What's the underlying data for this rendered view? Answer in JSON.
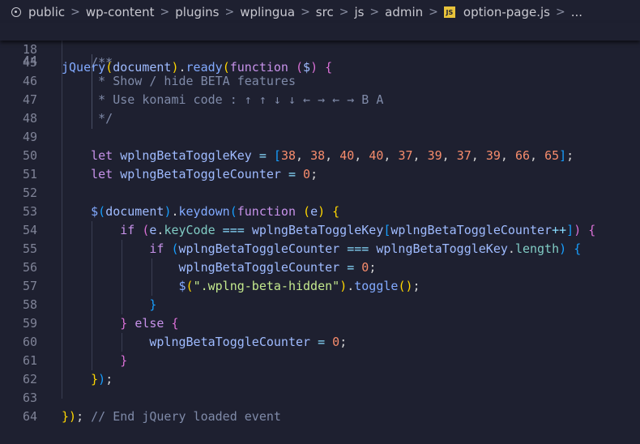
{
  "breadcrumb": {
    "items": [
      "public",
      "wp-content",
      "plugins",
      "wplingua",
      "src",
      "js",
      "admin",
      "option-page.js",
      "..."
    ],
    "separator": ">",
    "file_icon": "JS"
  },
  "sticky": {
    "line_number": "18",
    "tokens": [
      {
        "t": "jQuery",
        "c": "fn"
      },
      {
        "t": "(",
        "c": "yl"
      },
      {
        "t": "document",
        "c": "var"
      },
      {
        "t": ")",
        "c": "yl"
      },
      {
        "t": ".",
        "c": "pl"
      },
      {
        "t": "ready",
        "c": "fn"
      },
      {
        "t": "(",
        "c": "yl"
      },
      {
        "t": "function",
        "c": "kw"
      },
      {
        "t": " ",
        "c": "pl"
      },
      {
        "t": "(",
        "c": "pk"
      },
      {
        "t": "$",
        "c": "var"
      },
      {
        "t": ")",
        "c": "pk"
      },
      {
        "t": " ",
        "c": "pl"
      },
      {
        "t": "{",
        "c": "pk"
      }
    ]
  },
  "peek_line_number": "44",
  "lines": [
    {
      "n": "45",
      "indent": "    ",
      "tokens": [
        {
          "t": "/**",
          "c": "cm"
        }
      ]
    },
    {
      "n": "46",
      "indent": "     ",
      "tokens": [
        {
          "t": "* Show / hide BETA features",
          "c": "cm"
        }
      ]
    },
    {
      "n": "47",
      "indent": "     ",
      "tokens": [
        {
          "t": "* Use konami code : ↑ ↑ ↓ ↓ ← → ← → B A",
          "c": "cm"
        }
      ]
    },
    {
      "n": "48",
      "indent": "     ",
      "tokens": [
        {
          "t": "*/",
          "c": "cm"
        }
      ]
    },
    {
      "n": "49",
      "indent": "",
      "tokens": []
    },
    {
      "n": "50",
      "indent": "    ",
      "tokens": [
        {
          "t": "let",
          "c": "kw"
        },
        {
          "t": " ",
          "c": "pl"
        },
        {
          "t": "wplngBetaToggleKey",
          "c": "var"
        },
        {
          "t": " = ",
          "c": "op"
        },
        {
          "t": "[",
          "c": "bl"
        },
        {
          "t": "38",
          "c": "num"
        },
        {
          "t": ", ",
          "c": "pl"
        },
        {
          "t": "38",
          "c": "num"
        },
        {
          "t": ", ",
          "c": "pl"
        },
        {
          "t": "40",
          "c": "num"
        },
        {
          "t": ", ",
          "c": "pl"
        },
        {
          "t": "40",
          "c": "num"
        },
        {
          "t": ", ",
          "c": "pl"
        },
        {
          "t": "37",
          "c": "num"
        },
        {
          "t": ", ",
          "c": "pl"
        },
        {
          "t": "39",
          "c": "num"
        },
        {
          "t": ", ",
          "c": "pl"
        },
        {
          "t": "37",
          "c": "num"
        },
        {
          "t": ", ",
          "c": "pl"
        },
        {
          "t": "39",
          "c": "num"
        },
        {
          "t": ", ",
          "c": "pl"
        },
        {
          "t": "66",
          "c": "num"
        },
        {
          "t": ", ",
          "c": "pl"
        },
        {
          "t": "65",
          "c": "num"
        },
        {
          "t": "]",
          "c": "bl"
        },
        {
          "t": ";",
          "c": "pl"
        }
      ]
    },
    {
      "n": "51",
      "indent": "    ",
      "tokens": [
        {
          "t": "let",
          "c": "kw"
        },
        {
          "t": " ",
          "c": "pl"
        },
        {
          "t": "wplngBetaToggleCounter",
          "c": "var"
        },
        {
          "t": " = ",
          "c": "op"
        },
        {
          "t": "0",
          "c": "num"
        },
        {
          "t": ";",
          "c": "pl"
        }
      ]
    },
    {
      "n": "52",
      "indent": "",
      "tokens": []
    },
    {
      "n": "53",
      "indent": "    ",
      "tokens": [
        {
          "t": "$",
          "c": "fn"
        },
        {
          "t": "(",
          "c": "bl"
        },
        {
          "t": "document",
          "c": "var"
        },
        {
          "t": ")",
          "c": "bl"
        },
        {
          "t": ".",
          "c": "pl"
        },
        {
          "t": "keydown",
          "c": "fn"
        },
        {
          "t": "(",
          "c": "bl"
        },
        {
          "t": "function",
          "c": "kw"
        },
        {
          "t": " ",
          "c": "pl"
        },
        {
          "t": "(",
          "c": "yl"
        },
        {
          "t": "e",
          "c": "var"
        },
        {
          "t": ")",
          "c": "yl"
        },
        {
          "t": " ",
          "c": "pl"
        },
        {
          "t": "{",
          "c": "yl"
        }
      ]
    },
    {
      "n": "54",
      "indent": "        ",
      "tokens": [
        {
          "t": "if",
          "c": "kw"
        },
        {
          "t": " ",
          "c": "pl"
        },
        {
          "t": "(",
          "c": "pk"
        },
        {
          "t": "e",
          "c": "var"
        },
        {
          "t": ".",
          "c": "pl"
        },
        {
          "t": "keyCode",
          "c": "prp"
        },
        {
          "t": " === ",
          "c": "op"
        },
        {
          "t": "wplngBetaToggleKey",
          "c": "var"
        },
        {
          "t": "[",
          "c": "bl"
        },
        {
          "t": "wplngBetaToggleCounter",
          "c": "var"
        },
        {
          "t": "++",
          "c": "op"
        },
        {
          "t": "]",
          "c": "bl"
        },
        {
          "t": ")",
          "c": "pk"
        },
        {
          "t": " ",
          "c": "pl"
        },
        {
          "t": "{",
          "c": "pk"
        }
      ]
    },
    {
      "n": "55",
      "indent": "            ",
      "tokens": [
        {
          "t": "if",
          "c": "kw"
        },
        {
          "t": " ",
          "c": "pl"
        },
        {
          "t": "(",
          "c": "bl"
        },
        {
          "t": "wplngBetaToggleCounter",
          "c": "var"
        },
        {
          "t": " === ",
          "c": "op"
        },
        {
          "t": "wplngBetaToggleKey",
          "c": "var"
        },
        {
          "t": ".",
          "c": "pl"
        },
        {
          "t": "length",
          "c": "prp"
        },
        {
          "t": ")",
          "c": "bl"
        },
        {
          "t": " ",
          "c": "pl"
        },
        {
          "t": "{",
          "c": "bl"
        }
      ]
    },
    {
      "n": "56",
      "indent": "                ",
      "tokens": [
        {
          "t": "wplngBetaToggleCounter",
          "c": "var"
        },
        {
          "t": " = ",
          "c": "op"
        },
        {
          "t": "0",
          "c": "num"
        },
        {
          "t": ";",
          "c": "pl"
        }
      ]
    },
    {
      "n": "57",
      "indent": "                ",
      "tokens": [
        {
          "t": "$",
          "c": "fn"
        },
        {
          "t": "(",
          "c": "yl"
        },
        {
          "t": "\".wplng-beta-hidden\"",
          "c": "str"
        },
        {
          "t": ")",
          "c": "yl"
        },
        {
          "t": ".",
          "c": "pl"
        },
        {
          "t": "toggle",
          "c": "fn"
        },
        {
          "t": "()",
          "c": "yl"
        },
        {
          "t": ";",
          "c": "pl"
        }
      ]
    },
    {
      "n": "58",
      "indent": "            ",
      "tokens": [
        {
          "t": "}",
          "c": "bl"
        }
      ]
    },
    {
      "n": "59",
      "indent": "        ",
      "tokens": [
        {
          "t": "}",
          "c": "pk"
        },
        {
          "t": " ",
          "c": "pl"
        },
        {
          "t": "else",
          "c": "kw"
        },
        {
          "t": " ",
          "c": "pl"
        },
        {
          "t": "{",
          "c": "pk"
        }
      ]
    },
    {
      "n": "60",
      "indent": "            ",
      "tokens": [
        {
          "t": "wplngBetaToggleCounter",
          "c": "var"
        },
        {
          "t": " = ",
          "c": "op"
        },
        {
          "t": "0",
          "c": "num"
        },
        {
          "t": ";",
          "c": "pl"
        }
      ]
    },
    {
      "n": "61",
      "indent": "        ",
      "tokens": [
        {
          "t": "}",
          "c": "pk"
        }
      ]
    },
    {
      "n": "62",
      "indent": "    ",
      "tokens": [
        {
          "t": "}",
          "c": "yl"
        },
        {
          "t": ")",
          "c": "bl"
        },
        {
          "t": ";",
          "c": "pl"
        }
      ]
    },
    {
      "n": "63",
      "indent": "",
      "tokens": []
    },
    {
      "n": "64",
      "indent": "",
      "tokens": [
        {
          "t": "}",
          "c": "yl"
        },
        {
          "t": ")",
          "c": "yl"
        },
        {
          "t": ";",
          "c": "pl"
        },
        {
          "t": " ",
          "c": "pl"
        },
        {
          "t": "// End jQuery loaded event",
          "c": "cm"
        }
      ]
    }
  ]
}
